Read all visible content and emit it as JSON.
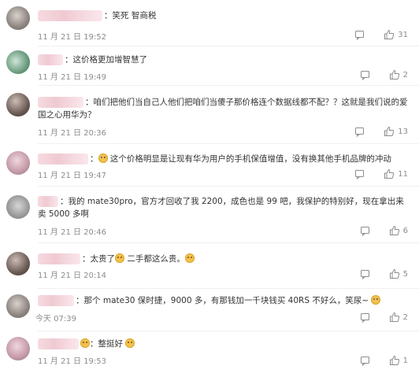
{
  "comments": [
    {
      "text": "笑死 智商税",
      "time": "11 月 21 日 19:52",
      "likes": "31"
    },
    {
      "text": "这价格更加增智慧了",
      "time": "11 月 21 日 19:49",
      "likes": "2"
    },
    {
      "text": "咱们把他们当自己人他们把咱们当傻子那价格连个数据线都不配？？这就是我们说的爱国之心用华为？",
      "time": "11 月 21 日 20:36",
      "likes": "13"
    },
    {
      "text": "这个价格明显是让现有华为用户的手机保值增值，没有换其他手机品牌的冲动",
      "time": "11 月 21 日 19:47",
      "likes": "11"
    },
    {
      "text": "我的 mate30pro，官方才回收了我 2200，成色也是 99 吧，我保护的特别好，现在拿出来卖 5000 多啊",
      "time": "11 月 21 日 20:46",
      "likes": "6"
    },
    {
      "text_a": "太贵了",
      "text_b": "二手都这么贵。",
      "time": "11 月 21 日 20:14",
      "likes": "5"
    },
    {
      "text": "那个 mate30 保时捷，9000 多，有那钱加一千块钱买 40RS 不好么，笑尿~",
      "time": "今天 07:39",
      "likes": "2"
    },
    {
      "text": "整挺好",
      "time": "11 月 21 日 19:53",
      "likes": "1"
    }
  ],
  "icons": {
    "reply": "reply-icon",
    "like": "thumbs-up-icon",
    "emoji": "emoji-icon"
  },
  "colors": {
    "text": "#333333",
    "meta": "#8c8c8c"
  }
}
